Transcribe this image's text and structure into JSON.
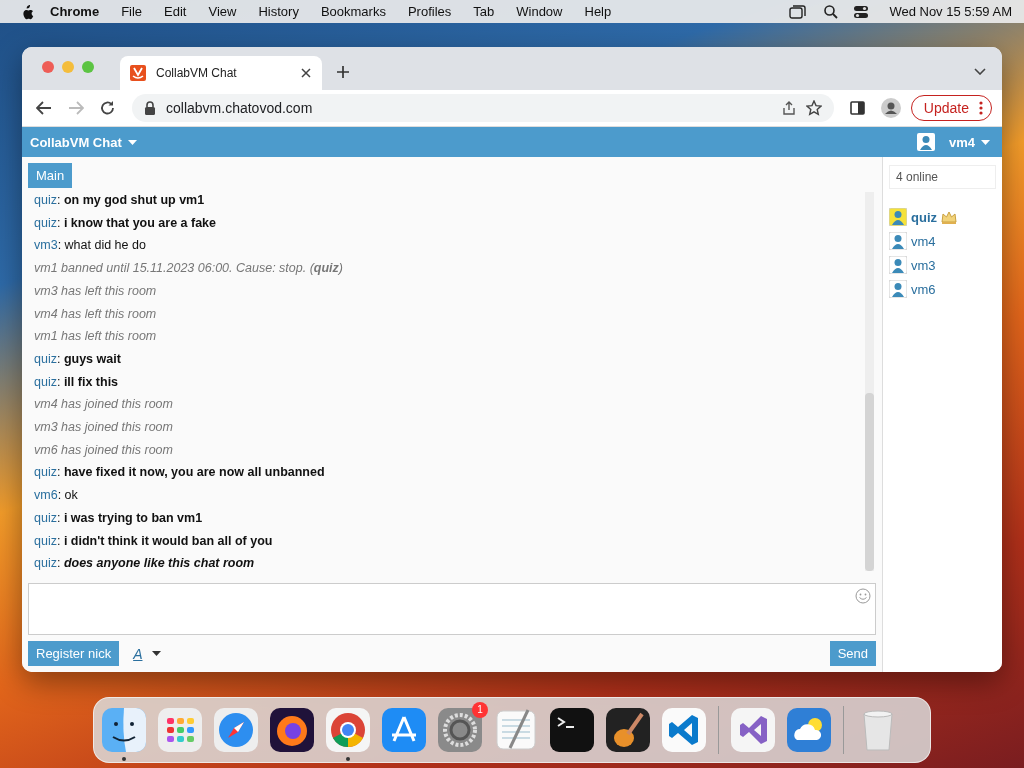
{
  "menu_bar": {
    "app": "Chrome",
    "items": [
      "File",
      "Edit",
      "View",
      "History",
      "Bookmarks",
      "Profiles",
      "Tab",
      "Window",
      "Help"
    ],
    "clock": "Wed Nov 15  5:59 AM"
  },
  "browser": {
    "tabs": [
      {
        "title": "CollabVM Chat",
        "selected": true
      }
    ],
    "address": "collabvm.chatovod.com",
    "update_button": "Update"
  },
  "chat": {
    "title": "CollabVM Chat",
    "current_user": "vm4",
    "rooms": [
      {
        "label": "Main",
        "selected": true
      }
    ],
    "messages": [
      {
        "kind": "message",
        "user": "quiz",
        "text": ": **on my god shut up vm1**"
      },
      {
        "kind": "message",
        "user": "quiz",
        "text": ": **i know that you are a fake**"
      },
      {
        "kind": "message",
        "user": "vm3",
        "text": ": what did he do"
      },
      {
        "kind": "system",
        "text": "vm1 banned until 15.11.2023 06:00. Cause: stop. (**quiz**)"
      },
      {
        "kind": "system",
        "text": "vm3 has left this room"
      },
      {
        "kind": "system",
        "text": "vm4 has left this room"
      },
      {
        "kind": "system",
        "text": "vm1 has left this room"
      },
      {
        "kind": "message",
        "user": "quiz",
        "text": ": **guys wait**"
      },
      {
        "kind": "message",
        "user": "quiz",
        "text": ": **ill fix this**"
      },
      {
        "kind": "system",
        "text": "vm4 has joined this room"
      },
      {
        "kind": "system",
        "text": "vm3 has joined this room"
      },
      {
        "kind": "system",
        "text": "vm6 has joined this room"
      },
      {
        "kind": "message",
        "user": "quiz",
        "text": ": **have fixed it now, you are now all unbanned**"
      },
      {
        "kind": "message",
        "user": "vm6",
        "text": ": ok"
      },
      {
        "kind": "message",
        "user": "quiz",
        "text": ": **i was trying to ban vm1**"
      },
      {
        "kind": "message",
        "user": "quiz",
        "text": ": **i didn't think it would ban all of you**"
      },
      {
        "kind": "message",
        "user": "quiz",
        "text": ": **does anyone like this chat room**",
        "italic": true
      }
    ],
    "register_button": "Register nick",
    "font_button": "A",
    "send_button": "Send",
    "online_count": "4 online",
    "users": [
      {
        "name": "quiz",
        "owner": true
      },
      {
        "name": "vm4",
        "owner": false
      },
      {
        "name": "vm3",
        "owner": false
      },
      {
        "name": "vm6",
        "owner": false
      }
    ]
  },
  "dock": {
    "items": [
      {
        "kind": "finder",
        "running": true
      },
      {
        "kind": "launchpad",
        "running": false
      },
      {
        "kind": "safari",
        "running": false
      },
      {
        "kind": "firefox",
        "running": false
      },
      {
        "kind": "chrome",
        "running": true
      },
      {
        "kind": "appstore",
        "running": false
      },
      {
        "kind": "settings",
        "running": false,
        "badge": "1"
      },
      {
        "kind": "textedit",
        "running": false
      },
      {
        "kind": "terminal",
        "running": false
      },
      {
        "kind": "garageband",
        "running": false
      },
      {
        "kind": "vscode",
        "running": false
      },
      {
        "kind": "separator"
      },
      {
        "kind": "visualstudio",
        "running": false
      },
      {
        "kind": "weather",
        "running": false
      },
      {
        "kind": "separator"
      },
      {
        "kind": "trash",
        "running": false
      }
    ]
  }
}
